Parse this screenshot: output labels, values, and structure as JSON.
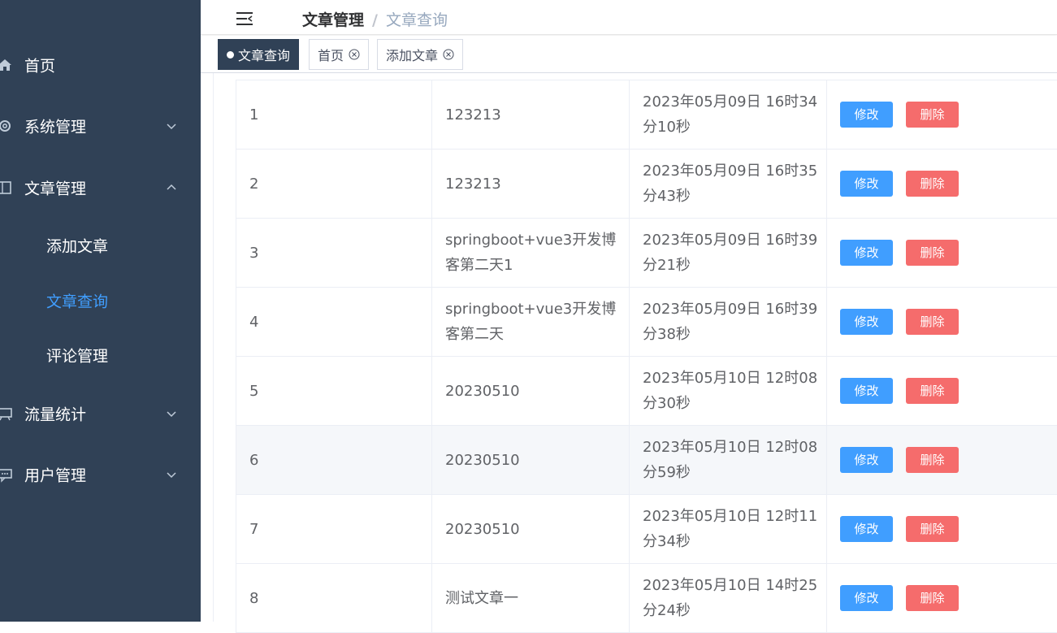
{
  "sidebar": {
    "items": [
      {
        "label": "首页",
        "icon": "home-icon"
      },
      {
        "label": "系统管理",
        "icon": "gear-icon"
      },
      {
        "label": "文章管理",
        "icon": "document-icon"
      },
      {
        "label": "流量统计",
        "icon": "presentation-icon"
      },
      {
        "label": "用户管理",
        "icon": "comment-icon"
      }
    ],
    "sub_items": [
      {
        "label": "添加文章"
      },
      {
        "label": "文章查询"
      },
      {
        "label": "评论管理"
      }
    ],
    "active_sub": "文章查询",
    "bg_color": "#304156",
    "active_color": "#409eff"
  },
  "header": {
    "breadcrumb": [
      "文章管理",
      "/",
      "文章查询"
    ]
  },
  "tags": [
    {
      "label": "文章查询",
      "active": true
    },
    {
      "label": "首页",
      "active": false
    },
    {
      "label": "添加文章",
      "active": false
    }
  ],
  "table": {
    "rows": [
      {
        "id": "1",
        "title": "123213",
        "time": "2023年05月09日 16时34分10秒"
      },
      {
        "id": "2",
        "title": "123213",
        "time": "2023年05月09日 16时35分43秒"
      },
      {
        "id": "3",
        "title": "springboot+vue3开发博客第二天1",
        "time": "2023年05月09日 16时39分21秒"
      },
      {
        "id": "4",
        "title": "springboot+vue3开发博客第二天",
        "time": "2023年05月09日 16时39分38秒"
      },
      {
        "id": "5",
        "title": "20230510",
        "time": "2023年05月10日 12时08分30秒"
      },
      {
        "id": "6",
        "title": "20230510",
        "time": "2023年05月10日 12时08分59秒"
      },
      {
        "id": "7",
        "title": "20230510",
        "time": "2023年05月10日 12时11分34秒"
      },
      {
        "id": "8",
        "title": "测试文章一",
        "time": "2023年05月10日 14时25分24秒"
      }
    ],
    "edit_label": "修改",
    "delete_label": "删除",
    "edit_color": "#409eff",
    "delete_color": "#f56c6c"
  }
}
